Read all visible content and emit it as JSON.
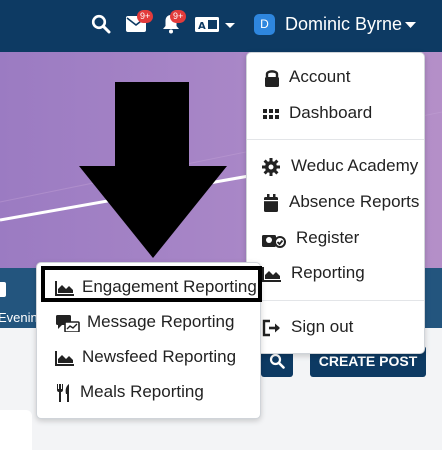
{
  "topbar": {
    "mail_badge": "9+",
    "notifications_badge": "9+",
    "user": {
      "avatar_letter": "D",
      "name": "Dominic Byrne"
    }
  },
  "tile": {
    "label": "Evenin"
  },
  "actions": {
    "create_post_label": "CREATE POST"
  },
  "user_menu": {
    "items": [
      {
        "label": "Account",
        "icon": "lock-icon"
      },
      {
        "label": "Dashboard",
        "icon": "grid-icon"
      },
      {
        "label": "Weduc Academy",
        "icon": "gear-icon"
      },
      {
        "label": "Absence Reports",
        "icon": "calendar-icon"
      },
      {
        "label": "Register",
        "icon": "user-check-icon"
      },
      {
        "label": "Reporting",
        "icon": "area-chart-icon"
      },
      {
        "label": "Sign out",
        "icon": "sign-out-icon"
      }
    ]
  },
  "reporting_submenu": {
    "items": [
      {
        "label": "Engagement Reporting",
        "icon": "area-chart-icon",
        "highlighted": true
      },
      {
        "label": "Message Reporting",
        "icon": "message-report-icon"
      },
      {
        "label": "Newsfeed Reporting",
        "icon": "area-chart-icon"
      },
      {
        "label": "Meals Reporting",
        "icon": "utensils-icon"
      }
    ]
  },
  "colors": {
    "navy": "#0d3a63",
    "badge_red": "#e23b3b",
    "hero_purple": "#a987c7"
  }
}
